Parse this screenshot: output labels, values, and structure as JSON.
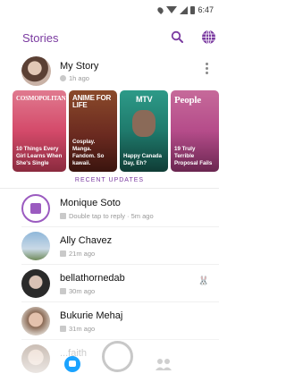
{
  "status": {
    "time": "6:47"
  },
  "header": {
    "title": "Stories",
    "search_icon": "search-icon",
    "globe_icon": "globe-icon"
  },
  "my_story": {
    "name": "My Story",
    "time": "1h ago"
  },
  "discover": [
    {
      "brand": "COSMOPOLITAN",
      "caption": "10 Things Every Girl Learns When She's Single",
      "color": "#d44a6a"
    },
    {
      "brand": "ANIME FOR LIFE",
      "caption": "Cosplay. Manga. Fandom. So kawaii.",
      "color": "#6b2a20"
    },
    {
      "brand": "MTV",
      "caption": "Happy Canada Day, Eh?",
      "color": "#1f7a6c"
    },
    {
      "brand": "People",
      "caption": "19 Truly Terrible Proposal Fails",
      "color": "#b54c8a"
    }
  ],
  "recent_label": "RECENT UPDATES",
  "recent": [
    {
      "name": "Monique Soto",
      "sub": "Double tap to reply · 5m ago"
    },
    {
      "name": "Ally Chavez",
      "sub": "21m ago"
    },
    {
      "name": "bellathornedab",
      "sub": "30m ago"
    },
    {
      "name": "Bukurie Mehaj",
      "sub": "31m ago"
    },
    {
      "name": "...faith",
      "sub": ""
    }
  ]
}
